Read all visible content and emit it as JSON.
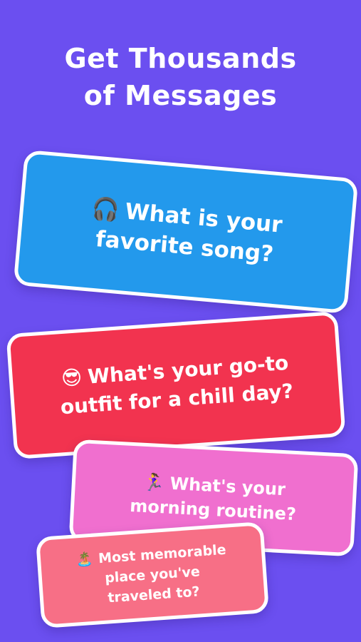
{
  "headline": {
    "line1": "Get Thousands",
    "line2": "of Messages"
  },
  "cards": [
    {
      "emoji": "🎧",
      "icon_name": "headphones-icon",
      "line1": "What is your",
      "line2": "favorite song?",
      "color": "#2399ec"
    },
    {
      "emoji": "😎",
      "icon_name": "sunglasses-face-icon",
      "line1": "What's your go-to",
      "line2": "outfit for a chill day?",
      "color": "#f2334f"
    },
    {
      "emoji": "🏃‍♀️",
      "icon_name": "running-woman-icon",
      "line1": "What's your",
      "line2": "morning routine?",
      "color": "#f06fcf"
    },
    {
      "emoji": "🏝️",
      "icon_name": "desert-island-icon",
      "line1": "Most memorable",
      "line2": "place you've",
      "line3": "traveled to?",
      "color": "#f76f86"
    }
  ],
  "colors": {
    "background": "#6b4ff0",
    "card_border": "#ffffff",
    "text": "#ffffff"
  }
}
